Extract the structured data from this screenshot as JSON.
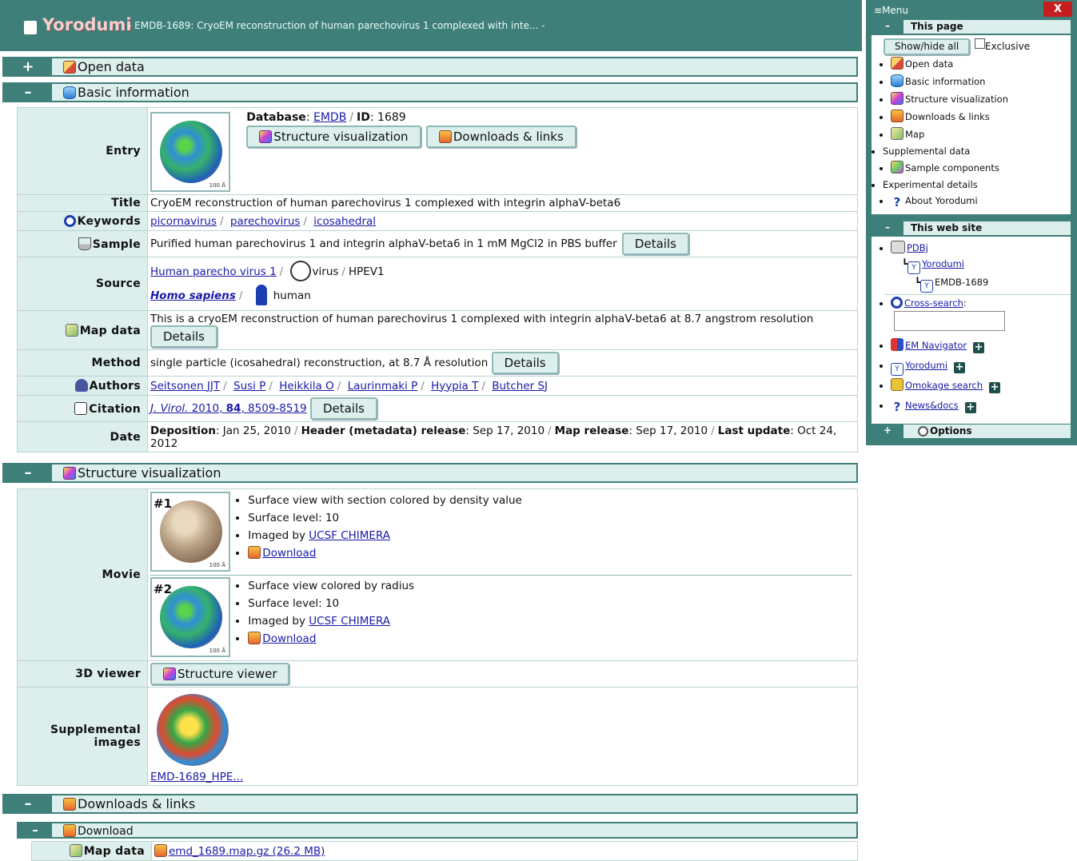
{
  "header": {
    "app_name": "Yorodumi",
    "subtitle": "- EMDB-1689: CryoEM reconstruction of human parechovirus 1 complexed with inte... -"
  },
  "sections": {
    "open_data": {
      "toggle": "+",
      "label": "Open data"
    },
    "basic_information": {
      "toggle": "–",
      "label": "Basic information"
    },
    "structure_visualization": {
      "toggle": "–",
      "label": "Structure visualization"
    },
    "downloads_links": {
      "toggle": "–",
      "label": "Downloads & links"
    },
    "download": {
      "toggle": "–",
      "label": "Download"
    }
  },
  "basic": {
    "entry": {
      "key": "Entry",
      "database_label": "Database",
      "database_value": "EMDB",
      "id_label": "ID",
      "id_value": "1689",
      "btn_structure_visualization": "Structure visualization",
      "btn_downloads_links": "Downloads & links",
      "scale_bar": "100 Å"
    },
    "title": {
      "key": "Title",
      "value": "CryoEM reconstruction of human parechovirus 1 complexed with integrin alphaV-beta6"
    },
    "keywords": {
      "key": "Keywords",
      "items": [
        "picornavirus",
        "parechovirus",
        "icosahedral"
      ]
    },
    "sample": {
      "key": "Sample",
      "value": "Purified human parechovirus 1 and integrin alphaV-beta6 in 1 mM MgCl2 in PBS buffer",
      "details": "Details"
    },
    "source": {
      "key": "Source",
      "line1_link": "Human parecho virus 1",
      "line1_type": "virus",
      "line1_name": "HPEV1",
      "line2_link": "Homo sapiens",
      "line2_name": "human"
    },
    "map_data": {
      "key": "Map data",
      "value": "This is a cryoEM reconstruction of human parechovirus 1 complexed with integrin alphaV-beta6 at 8.7 angstrom resolution",
      "details": "Details"
    },
    "method": {
      "key": "Method",
      "value": "single particle (icosahedral) reconstruction, at 8.7 Å resolution",
      "details": "Details"
    },
    "authors": {
      "key": "Authors",
      "items": [
        "Seitsonen JJT",
        "Susi P",
        "Heikkila O",
        "Laurinmaki P",
        "Hyypia T",
        "Butcher SJ"
      ]
    },
    "citation": {
      "key": "Citation",
      "journal": "J. Virol.",
      "year": "2010",
      "volume": "84",
      "pages": "8509-8519",
      "details": "Details"
    },
    "date": {
      "key": "Date",
      "deposition_label": "Deposition",
      "deposition_value": "Jan 25, 2010",
      "header_label": "Header (metadata) release",
      "header_value": "Sep 17, 2010",
      "map_label": "Map release",
      "map_value": "Sep 17, 2010",
      "update_label": "Last update",
      "update_value": "Oct 24, 2012"
    }
  },
  "structure_vis": {
    "movie_key": "Movie",
    "movies": [
      {
        "num": "#1",
        "line1": "Surface view with section colored by density value",
        "line2": "Surface level: 10",
        "imaged_by": "Imaged by",
        "imaged_link": "UCSF CHIMERA",
        "download": "Download",
        "scale_bar": "100 Å"
      },
      {
        "num": "#2",
        "line1": "Surface view colored by radius",
        "line2": "Surface level: 10",
        "imaged_by": "Imaged by",
        "imaged_link": "UCSF CHIMERA",
        "download": "Download",
        "scale_bar": "100 Å"
      }
    ],
    "viewer_key": "3D viewer",
    "viewer_btn": "Structure viewer",
    "supp_key": "Supplemental images",
    "supp_caption": "EMD-1689_HPE..."
  },
  "downloads": {
    "map_key": "Map data",
    "map_file": "emd_1689.map.gz (26.2 MB)"
  },
  "menu": {
    "title": "Menu",
    "close": "X",
    "this_page": {
      "toggle": "–",
      "label": "This page"
    },
    "show_hide_all": "Show/hide all",
    "exclusive": "Exclusive",
    "page_items": [
      "Open data",
      "Basic information",
      "Structure visualization",
      "Downloads & links",
      "Map",
      "Supplemental data",
      "Sample components",
      "Experimental details",
      "About Yorodumi"
    ],
    "this_site": {
      "toggle": "–",
      "label": "This web site"
    },
    "tree": [
      "PDBj",
      "Yorodumi",
      "EMDB-1689"
    ],
    "cross_search": "Cross-search",
    "site_links": [
      "EM Navigator",
      "Yorodumi",
      "Omokage search",
      "News&docs"
    ],
    "options": {
      "toggle": "+",
      "label": "Options"
    }
  }
}
